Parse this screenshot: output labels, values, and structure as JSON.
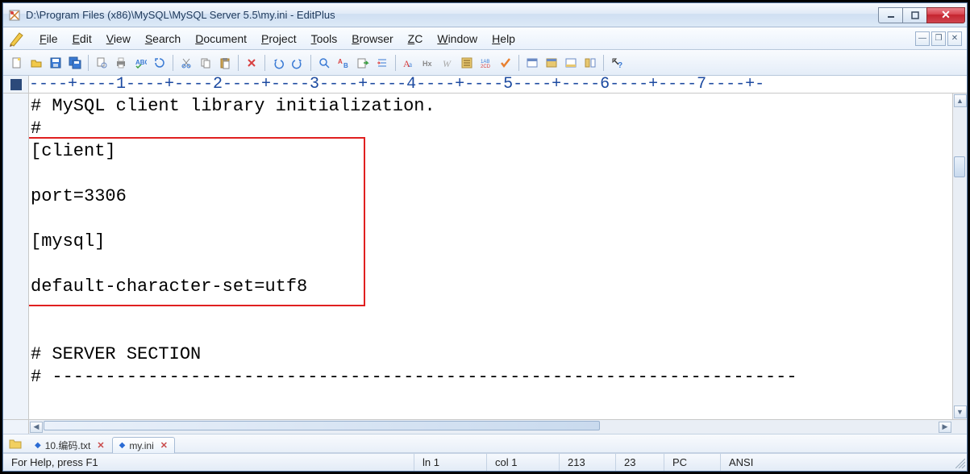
{
  "title": "D:\\Program Files (x86)\\MySQL\\MySQL Server 5.5\\my.ini - EditPlus",
  "menu": {
    "file": "File",
    "file_u": "F",
    "edit": "Edit",
    "edit_u": "E",
    "view": "View",
    "view_u": "V",
    "search": "Search",
    "search_u": "S",
    "document": "Document",
    "document_u": "D",
    "project": "Project",
    "project_u": "P",
    "tools": "Tools",
    "tools_u": "T",
    "browser": "Browser",
    "browser_u": "B",
    "zc": "ZC",
    "zc_u": "Z",
    "window": "Window",
    "window_u": "W",
    "help": "Help",
    "help_u": "H"
  },
  "ruler": "----+----1----+----2----+----3----+----4----+----5----+----6----+----7----+-",
  "editor_lines": [
    "# MySQL client library initialization.",
    "#",
    "[client]",
    "",
    "port=3306",
    "",
    "[mysql]",
    "",
    "default-character-set=utf8",
    "",
    "",
    "# SERVER SECTION",
    "# ----------------------------------------------------------------------"
  ],
  "tabs": [
    {
      "label": "10.编码.txt",
      "active": false
    },
    {
      "label": "my.ini",
      "active": true
    }
  ],
  "status": {
    "help": "For Help, press F1",
    "ln": "ln 1",
    "col": "col 1",
    "total": "213",
    "sel": "23",
    "mode": "PC",
    "encoding": "ANSI"
  }
}
